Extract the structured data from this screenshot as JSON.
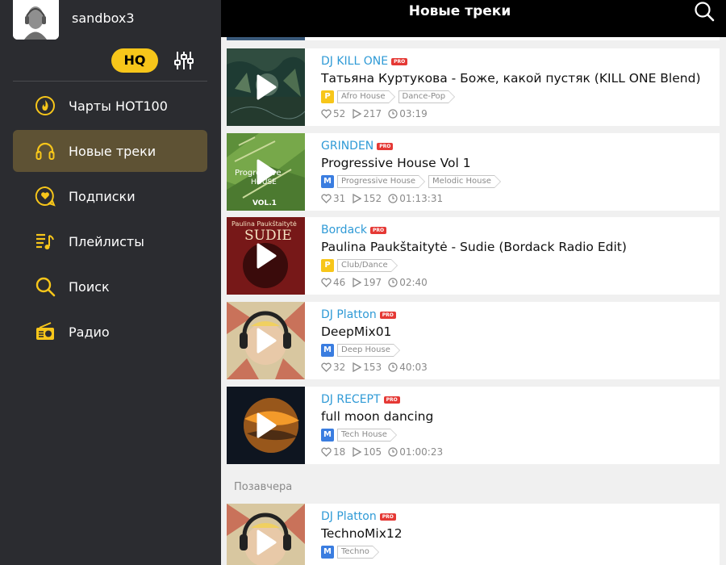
{
  "user": {
    "name": "sandbox3"
  },
  "sidebar": {
    "hq_label": "HQ",
    "items": [
      {
        "label": "Чарты HOT100",
        "icon": "fire-icon"
      },
      {
        "label": "Новые треки",
        "icon": "headphones-icon",
        "active": true
      },
      {
        "label": "Подписки",
        "icon": "heart-bubble-icon"
      },
      {
        "label": "Плейлисты",
        "icon": "playlist-icon"
      },
      {
        "label": "Поиск",
        "icon": "search-icon"
      },
      {
        "label": "Радио",
        "icon": "radio-icon"
      }
    ]
  },
  "header": {
    "title": "Новые треки"
  },
  "colors": {
    "accent": "#f7c61a",
    "link": "#2f9ad6",
    "pro": "#e53935",
    "quality_p": "#f7c61a",
    "quality_m": "#3a7de0"
  },
  "tracks": [
    {
      "artist": "DJ KILL ONE",
      "pro": "PRO",
      "title": "Татьяна Куртукова - Боже, какой пустяк (KILL ONE Blend)",
      "quality": "P",
      "tags": [
        "Afro House",
        "Dance-Pop"
      ],
      "likes": "52",
      "plays": "217",
      "duration": "03:19"
    },
    {
      "artist": "GRINDEN",
      "pro": "PRO",
      "title": "Progressive House Vol 1",
      "quality": "M",
      "tags": [
        "Progressive House",
        "Melodic House"
      ],
      "likes": "31",
      "plays": "152",
      "duration": "01:13:31",
      "cover_text": [
        "Progressive",
        "HOUSE",
        "VOL.1"
      ]
    },
    {
      "artist": "Bordack",
      "pro": "PRO",
      "title": "Paulina Paukštaitytė - Sudie (Bordack Radio Edit)",
      "quality": "P",
      "tags": [
        "Club/Dance"
      ],
      "likes": "46",
      "plays": "197",
      "duration": "02:40",
      "cover_text": [
        "Paulina Paukštaitytė",
        "SUDIE"
      ]
    },
    {
      "artist": "DJ Platton",
      "pro": "PRO",
      "title": "DeepMix01",
      "quality": "M",
      "tags": [
        "Deep House"
      ],
      "likes": "32",
      "plays": "153",
      "duration": "40:03"
    },
    {
      "artist": "DJ RECEPT",
      "pro": "PRO",
      "title": "full moon dancing",
      "quality": "M",
      "tags": [
        "Tech House"
      ],
      "likes": "18",
      "plays": "105",
      "duration": "01:00:23"
    },
    {
      "artist": "DJ Platton",
      "pro": "PRO",
      "title": "TechnoMix12",
      "quality": "M",
      "tags": [
        "Techno"
      ]
    }
  ],
  "section": {
    "label": "Позавчера"
  }
}
